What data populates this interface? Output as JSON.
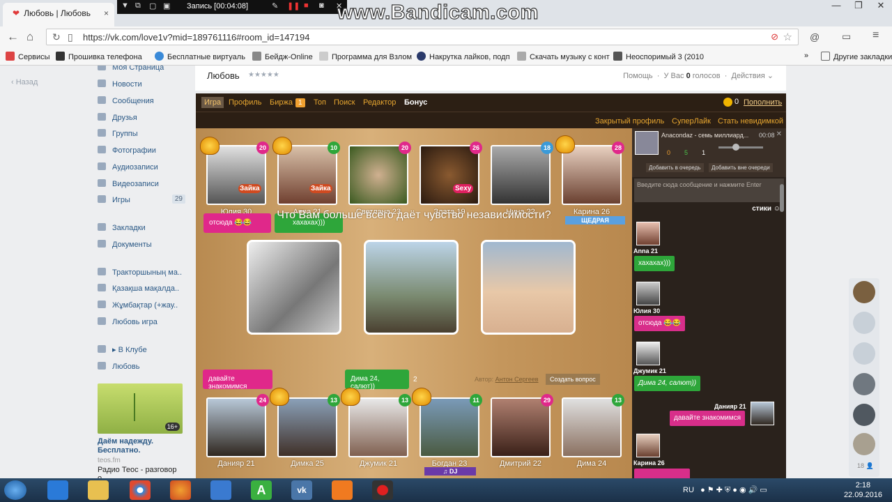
{
  "browser": {
    "tab_title": "Любовь | Любовь",
    "url": "https://vk.com/love1v?mid=189761116#room_id=147194",
    "bandicam_status": "Запись [00:04:08]",
    "watermark": "www.Bandicam.com",
    "bookmarks": [
      "Сервисы",
      "Прошивка телефона",
      "Бесплатные виртуаль",
      "Бейдж-Online",
      "Программа для Взлом",
      "Накрутка лайков, подп",
      "Скачать музыку с конт",
      "Неоспоримый 3 (2010"
    ],
    "other_bookmarks": "Другие закладки",
    "accent": "#e03a3a"
  },
  "vk": {
    "back_label": "Назад",
    "nav": [
      {
        "label": "Моя Страница"
      },
      {
        "label": "Новости"
      },
      {
        "label": "Сообщения"
      },
      {
        "label": "Друзья"
      },
      {
        "label": "Группы"
      },
      {
        "label": "Фотографии"
      },
      {
        "label": "Аудиозаписи"
      },
      {
        "label": "Видеозаписи"
      },
      {
        "label": "Игры",
        "count": "29"
      },
      {
        "label": "Закладки"
      },
      {
        "label": "Документы"
      },
      {
        "label": "Тракторшының ма.."
      },
      {
        "label": "Қазақша мақалда.."
      },
      {
        "label": "Жұмбақтар (+жау.."
      },
      {
        "label": "Любовь игра"
      },
      {
        "label": "▸ В Клубе"
      },
      {
        "label": "Любовь"
      }
    ],
    "ad": {
      "badge": "16+",
      "title": "Даём надежду. Бесплатно.",
      "source": "teos.fm",
      "text": "Радио Теос - разговор о"
    }
  },
  "app_header": {
    "title": "Любовь",
    "stars": "★★★★★",
    "help": "Помощь",
    "votes_prefix": "У Вас ",
    "votes_count": "0",
    "votes_suffix": " голосов",
    "actions": "Действия ⌄"
  },
  "game": {
    "tabs": [
      "Игра",
      "Профиль",
      "Биржа",
      "Топ",
      "Поиск",
      "Редактор",
      "Бонус"
    ],
    "birzha_count": "1",
    "coins": "0",
    "topup": "Пополнить",
    "sub_links": [
      "Закрытый профиль",
      "СуперЛайк",
      "Стать невидимкой"
    ],
    "question": "Что Вам больше всего даёт чувство независимости?",
    "author_label": "Автор:",
    "author_name": "Антон Сергеев",
    "ask_button": "Создать вопрос",
    "sticker_label": "Зайка",
    "sexy_label": "Sexy",
    "women": [
      {
        "name": "Юлия 30",
        "num": "20",
        "color": "#e0288a"
      },
      {
        "name": "Anna 21",
        "num": "10",
        "color": "#2ea63a"
      },
      {
        "name": "Светлана 23",
        "num": "20",
        "color": "#e0288a"
      },
      {
        "name": "Злата 19",
        "num": "26",
        "color": "#e0288a"
      },
      {
        "name": "Нина 22",
        "num": "18",
        "color": "#3a9ad8"
      },
      {
        "name": "Карина 26",
        "num": "28",
        "color": "#e0288a"
      }
    ],
    "men": [
      {
        "name": "Данияр 21",
        "num": "24",
        "color": "#e0288a"
      },
      {
        "name": "Димка 25",
        "num": "13",
        "color": "#2ea63a"
      },
      {
        "name": "Джумик 21",
        "num": "13",
        "color": "#2ea63a"
      },
      {
        "name": "Богдан 23",
        "num": "11",
        "color": "#2ea63a"
      },
      {
        "name": "Дмитрий 22",
        "num": "29",
        "color": "#e0288a"
      },
      {
        "name": "Дима 24",
        "num": "13",
        "color": "#2ea63a"
      }
    ],
    "bubble_top_1": "отсюда 😂😂",
    "bubble_top_2": "хахахах)))",
    "bubble_bot_1": "давайте знакомимся",
    "bubble_bot_2": "Дима 24, салют))",
    "bubble_bot_2_tail": "2",
    "tag_generous": "ЩЕДРАЯ",
    "tag_dj": "♫ DJ"
  },
  "chat": {
    "now_playing": "Anacondaz - семь миллиард...",
    "time": "00:08",
    "votes": [
      "0",
      "5",
      "1"
    ],
    "queue_btn": "Добавить в очередь",
    "queue_btn2": "Добавить вне очереди",
    "input_placeholder": "Введите сюда сообщение и нажмите Enter",
    "stickers": "стики",
    "messages": [
      {
        "name": "Anna 21",
        "text": "хахахах)))",
        "color": "green"
      },
      {
        "name": "Юлия 30",
        "text": "отсюда 😂😂",
        "color": "pink"
      },
      {
        "name": "Джумик 21",
        "text": "Дима 24, салют))",
        "color": "green"
      },
      {
        "name": "Данияр 21",
        "text": "давайте знакомимся",
        "color": "pink"
      },
      {
        "name": "Карина 26",
        "text": "",
        "color": "pink"
      }
    ]
  },
  "friends_count": "18 👤",
  "taskbar": {
    "lang": "RU",
    "time": "2:18",
    "date": "22.09.2016"
  }
}
